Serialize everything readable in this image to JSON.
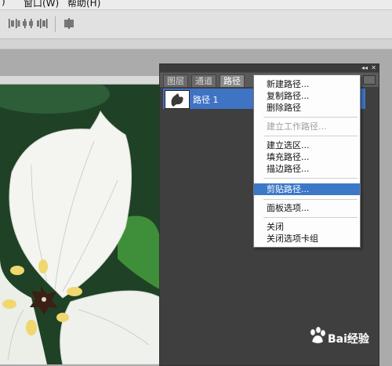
{
  "menubar": {
    "items": [
      {
        "label": ")"
      },
      {
        "label": "窗口(W)"
      },
      {
        "label": "帮助(H)"
      }
    ]
  },
  "options_bar": {
    "icons": [
      "distribute-left-icon",
      "distribute-center-icon",
      "distribute-right-icon",
      "auto-align-icon"
    ]
  },
  "panel": {
    "tabs": [
      {
        "label": "图层"
      },
      {
        "label": "通道"
      },
      {
        "label": "路径"
      }
    ],
    "active_tab": "路径",
    "path_item": {
      "label": "路径 1"
    }
  },
  "context_menu": {
    "items": [
      {
        "label": "新建路径...",
        "enabled": true
      },
      {
        "label": "复制路径...",
        "enabled": true
      },
      {
        "label": "删除路径",
        "enabled": true
      },
      {
        "label": "建立工作路径...",
        "enabled": false
      },
      {
        "label": "建立选区...",
        "enabled": true
      },
      {
        "label": "填充路径...",
        "enabled": true
      },
      {
        "label": "描边路径...",
        "enabled": true
      },
      {
        "label": "剪贴路径...",
        "enabled": true,
        "highlighted": true
      },
      {
        "label": "面板选项...",
        "enabled": true
      },
      {
        "label": "关闭",
        "enabled": true
      },
      {
        "label": "关闭选项卡组",
        "enabled": true
      }
    ]
  },
  "watermark": {
    "text": "Bai经验"
  },
  "colors": {
    "highlight": "#3c78c8",
    "panel_bg": "#3f3f3f",
    "selected_row": "#3f73c4"
  }
}
